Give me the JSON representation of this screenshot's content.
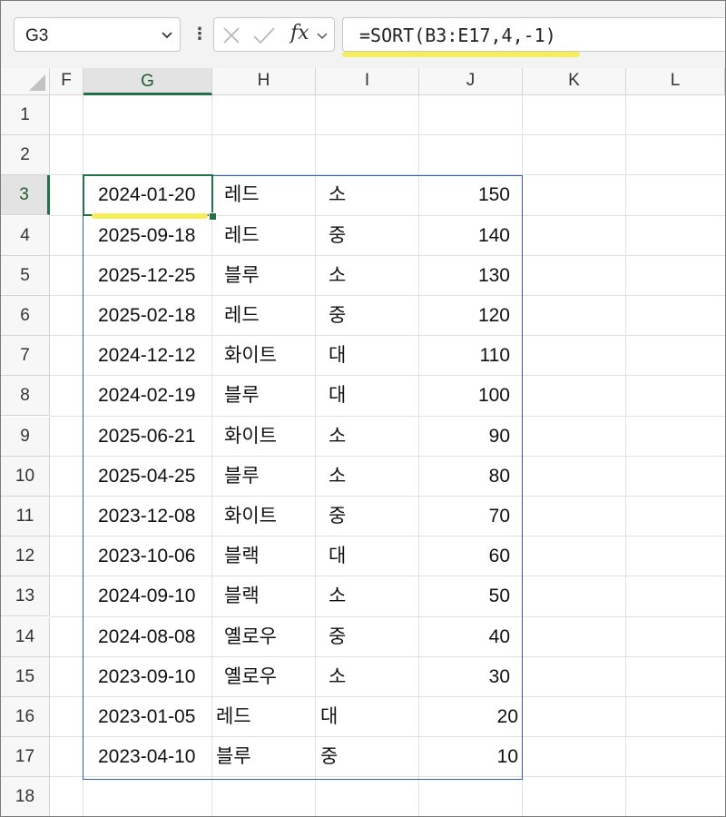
{
  "namebox": {
    "value": "G3"
  },
  "formula_bar": {
    "fx_label": "fx",
    "formula": "=SORT(B3:E17,4,-1)"
  },
  "columns": [
    "F",
    "G",
    "H",
    "I",
    "J",
    "K",
    "L"
  ],
  "selected_column": "G",
  "rows": [
    "1",
    "2",
    "3",
    "4",
    "5",
    "6",
    "7",
    "8",
    "9",
    "10",
    "11",
    "12",
    "13",
    "14",
    "15",
    "16",
    "17",
    "18"
  ],
  "selected_row": "3",
  "data_rows": [
    {
      "date": "2024-01-20",
      "color": "레드",
      "size": "소",
      "qty": "150"
    },
    {
      "date": "2025-09-18",
      "color": "레드",
      "size": "중",
      "qty": "140"
    },
    {
      "date": "2025-12-25",
      "color": "블루",
      "size": "소",
      "qty": "130"
    },
    {
      "date": "2025-02-18",
      "color": "레드",
      "size": "중",
      "qty": "120"
    },
    {
      "date": "2024-12-12",
      "color": "화이트",
      "size": "대",
      "qty": "110"
    },
    {
      "date": "2024-02-19",
      "color": "블루",
      "size": "대",
      "qty": "100"
    },
    {
      "date": "2025-06-21",
      "color": "화이트",
      "size": "소",
      "qty": "90"
    },
    {
      "date": "2025-04-25",
      "color": "블루",
      "size": "소",
      "qty": "80"
    },
    {
      "date": "2023-12-08",
      "color": "화이트",
      "size": "중",
      "qty": "70"
    },
    {
      "date": "2023-10-06",
      "color": "블랙",
      "size": "대",
      "qty": "60"
    },
    {
      "date": "2024-09-10",
      "color": "블랙",
      "size": "소",
      "qty": "50"
    },
    {
      "date": "2024-08-08",
      "color": "옐로우",
      "size": "중",
      "qty": "40"
    },
    {
      "date": "2023-09-10",
      "color": "옐로우",
      "size": "소",
      "qty": "30"
    },
    {
      "date": "2023-01-05",
      "color": "레드",
      "size": "대",
      "qty": "20"
    },
    {
      "date": "2023-04-10",
      "color": "블루",
      "size": "중",
      "qty": "10"
    }
  ],
  "colors": {
    "selection_green": "#217346",
    "range_border": "#2f5fb0",
    "highlight": "#f5ee56"
  },
  "icons": {
    "chevron": "chevron-down-icon",
    "more": "more-vertical-icon",
    "cancel": "cancel-x-icon",
    "enter": "enter-check-icon",
    "fx": "insert-function-icon"
  }
}
